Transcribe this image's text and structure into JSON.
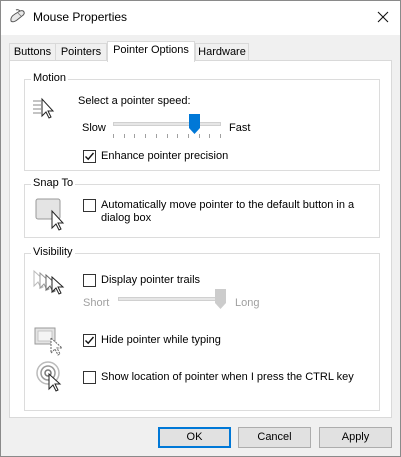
{
  "window": {
    "title": "Mouse Properties"
  },
  "tabs": [
    {
      "label": "Buttons"
    },
    {
      "label": "Pointers"
    },
    {
      "label": "Pointer Options"
    },
    {
      "label": "Hardware"
    }
  ],
  "motion": {
    "group_label": "Motion",
    "speed_label": "Select a pointer speed:",
    "slow_label": "Slow",
    "fast_label": "Fast",
    "speed_value": 0.75,
    "enhance_label": "Enhance pointer precision",
    "enhance_checked": true
  },
  "snap_to": {
    "group_label": "Snap To",
    "auto_line1": "Automatically move pointer to the default button in a",
    "auto_line2": "dialog box",
    "auto_checked": false
  },
  "visibility": {
    "group_label": "Visibility",
    "trails_label": "Display pointer trails",
    "trails_checked": false,
    "short_label": "Short",
    "long_label": "Long",
    "trails_value": 1.0,
    "hide_label": "Hide pointer while typing",
    "hide_checked": true,
    "ctrl_label": "Show location of pointer when I press the CTRL key",
    "ctrl_checked": false
  },
  "buttons": {
    "ok": "OK",
    "cancel": "Cancel",
    "apply": "Apply"
  },
  "colors": {
    "accent": "#0078d7",
    "window_bg": "#f0f0f0",
    "panel_bg": "#ffffff",
    "disabled_text": "#a0a0a0"
  },
  "icons": {
    "title": "mouse-icon",
    "close": "close-icon",
    "motion": "pointer-speed-icon",
    "snap": "snap-to-button-icon",
    "trails": "pointer-trails-icon",
    "hide": "hide-pointer-icon",
    "ctrl": "locate-pointer-icon"
  }
}
